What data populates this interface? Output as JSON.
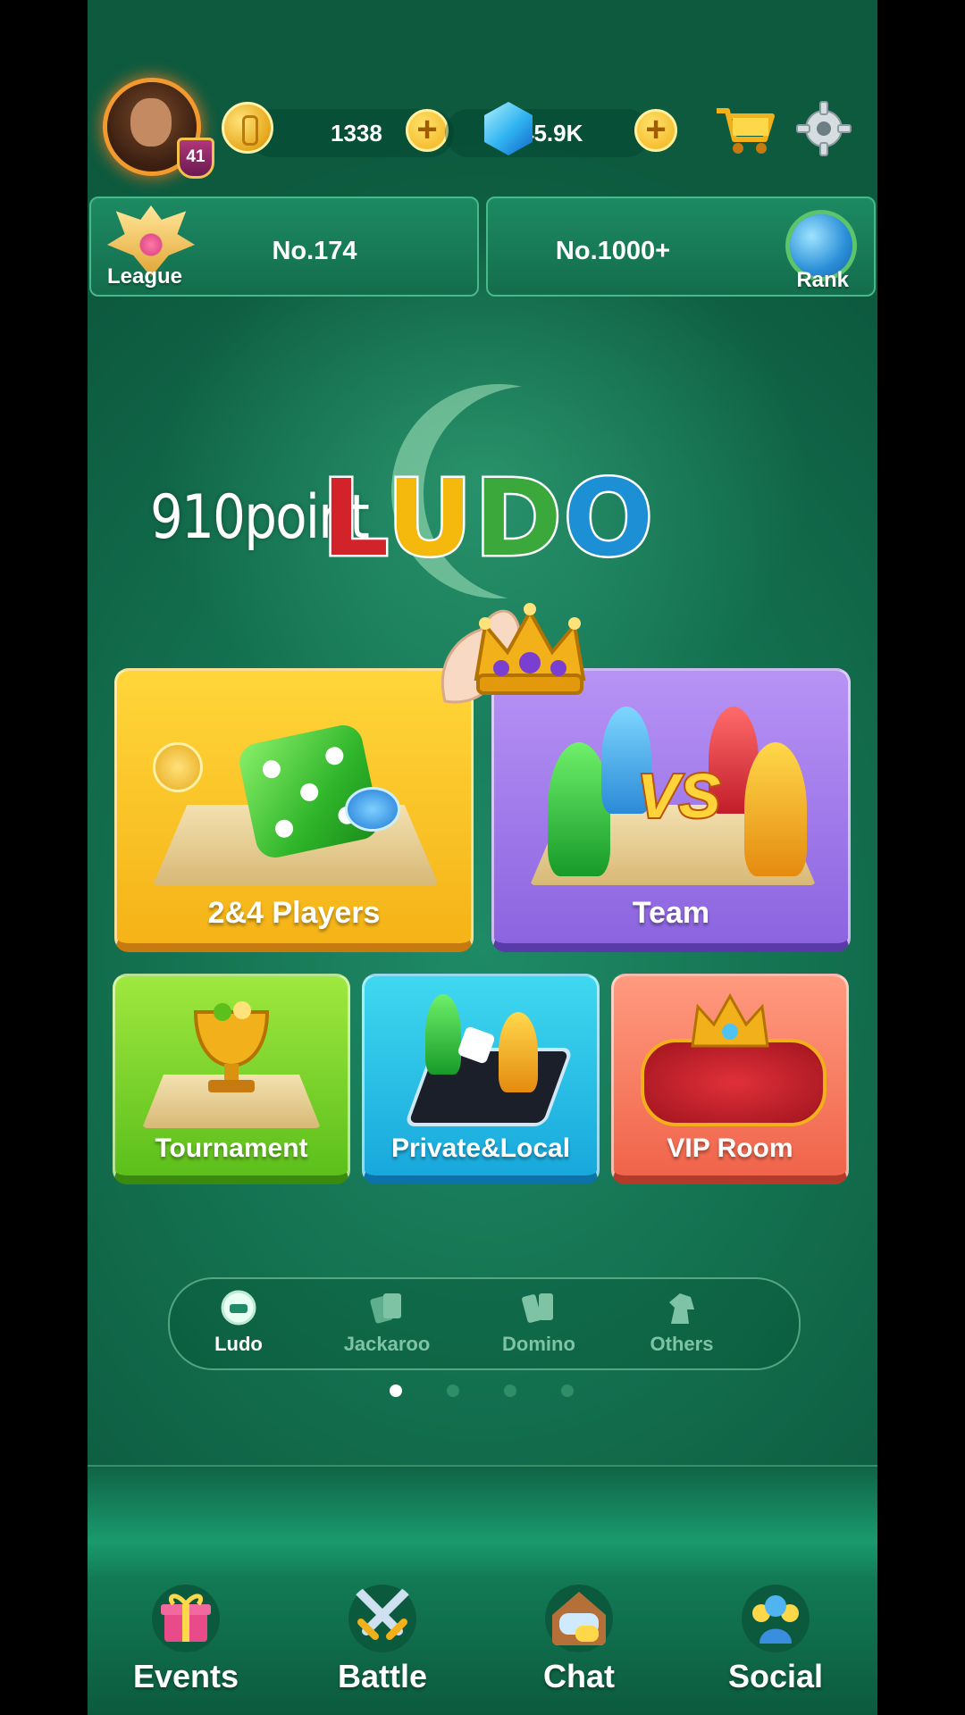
{
  "header": {
    "level": "41",
    "coins": "1338",
    "gems": "45.9K"
  },
  "ranks": {
    "league_label": "League",
    "league_value": "No.174",
    "rank_value": "No.1000+",
    "rank_label": "Rank"
  },
  "logo": {
    "watermark": "910point",
    "title_letters": [
      "L",
      "U",
      "D",
      "O"
    ]
  },
  "modes": {
    "players": "2&4 Players",
    "team": "Team",
    "vs": "VS",
    "tournament": "Tournament",
    "private": "Private&Local",
    "vip": "VIP Room"
  },
  "game_tabs": [
    {
      "label": "Ludo",
      "active": true
    },
    {
      "label": "Jackaroo",
      "active": false
    },
    {
      "label": "Domino",
      "active": false
    },
    {
      "label": "Others",
      "active": false
    }
  ],
  "page_dots": {
    "count": 4,
    "active_index": 0
  },
  "bottom_nav": [
    {
      "label": "Events"
    },
    {
      "label": "Battle"
    },
    {
      "label": "Chat"
    },
    {
      "label": "Social"
    }
  ],
  "colors": {
    "background": "#13704f",
    "coin": "#f2b01a",
    "gem": "#2fb2f0",
    "players_card": "#f5b317",
    "team_card": "#8c64e0",
    "tournament_card": "#5cbf1b",
    "private_card": "#18a8dc",
    "vip_card": "#f0644a"
  },
  "icons": {
    "avatar": "avatar",
    "coin": "coin-icon",
    "gem": "gem-icon",
    "cart": "cart-icon",
    "settings": "gear-icon",
    "league": "league-trophy-icon",
    "rank": "globe-icon"
  }
}
